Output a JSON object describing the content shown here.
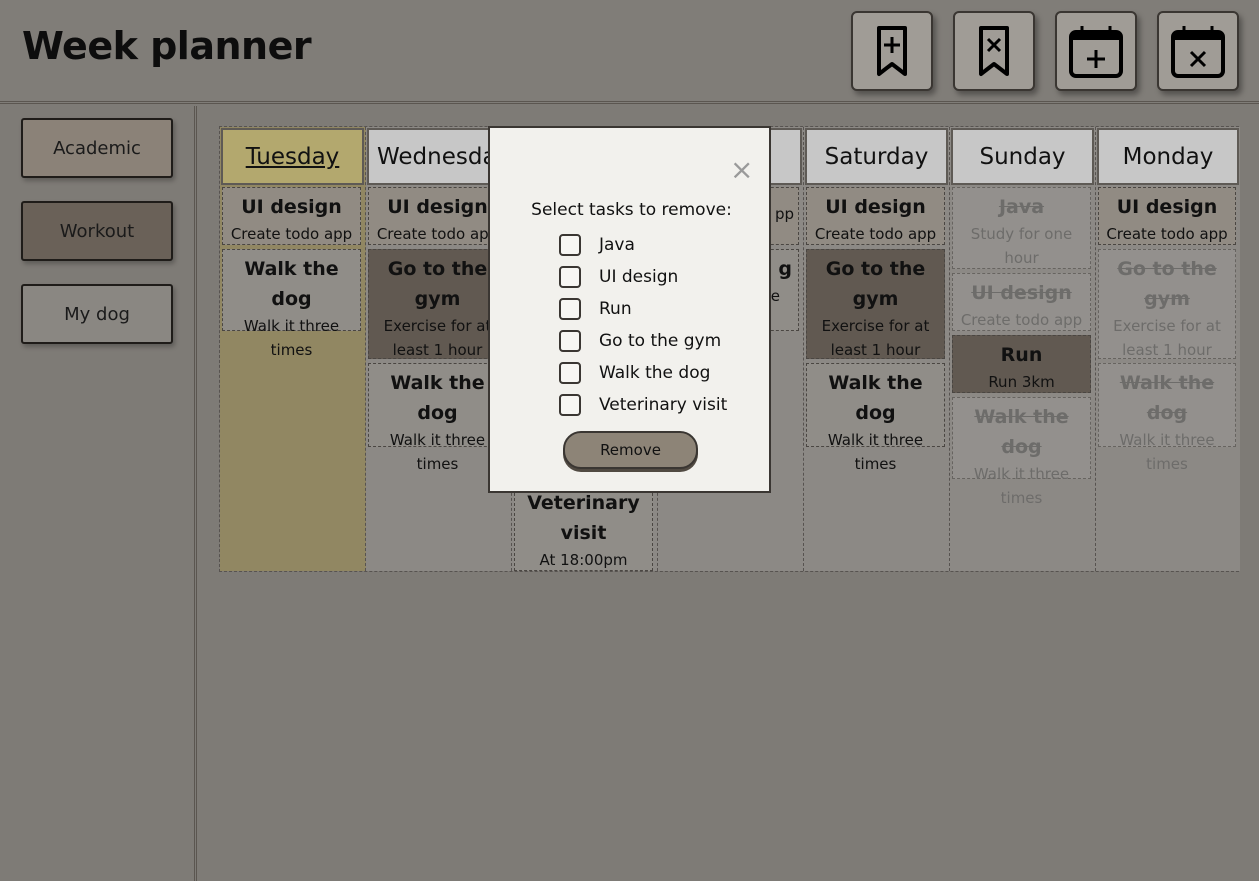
{
  "app": {
    "title": "Week planner"
  },
  "toolbar": {
    "buttons": [
      {
        "icon": "bookmark-add-icon"
      },
      {
        "icon": "bookmark-remove-icon"
      },
      {
        "icon": "calendar-add-icon"
      },
      {
        "icon": "calendar-remove-icon"
      }
    ]
  },
  "categories": [
    {
      "label": "Academic",
      "color": "#8b8278"
    },
    {
      "label": "Workout",
      "color": "#6a6158"
    },
    {
      "label": "My dog",
      "color": "#8a8782"
    }
  ],
  "days": [
    {
      "name": "Tuesday",
      "today": true,
      "tasks": [
        {
          "title": "UI design",
          "desc": "Create todo app"
        },
        {
          "title": "Walk the dog",
          "desc": "Walk it three times"
        }
      ]
    },
    {
      "name": "Wednesday",
      "tasks": [
        {
          "title": "UI design",
          "desc": "Create todo app"
        },
        {
          "title": "Go to the gym",
          "desc": "Exercise for at least 1 hour"
        },
        {
          "title": "Walk the dog",
          "desc": "Walk it three times"
        }
      ]
    },
    {
      "name": "",
      "tasks": [
        {
          "title": "Veterinary visit",
          "desc": "At 18:00pm"
        }
      ]
    },
    {
      "name": "",
      "tasks": [
        {
          "title": "",
          "desc": "pp"
        },
        {
          "title": "g",
          "desc": "e"
        }
      ]
    },
    {
      "name": "Saturday",
      "tasks": [
        {
          "title": "UI design",
          "desc": "Create todo app"
        },
        {
          "title": "Go to the gym",
          "desc": "Exercise for at least 1 hour"
        },
        {
          "title": "Walk the dog",
          "desc": "Walk it three times"
        }
      ]
    },
    {
      "name": "Sunday",
      "tasks": [
        {
          "title": "Java",
          "desc": "Study for one hour",
          "done": true
        },
        {
          "title": "UI design",
          "desc": "Create todo app",
          "done": true
        },
        {
          "title": "Run",
          "desc": "Run 3km"
        },
        {
          "title": "Walk the dog",
          "desc": "Walk it three times",
          "done": true
        }
      ]
    },
    {
      "name": "Monday",
      "tasks": [
        {
          "title": "UI design",
          "desc": "Create todo app"
        },
        {
          "title": "Go to the gym",
          "desc": "Exercise for at least 1 hour",
          "done": true
        },
        {
          "title": "Walk the dog",
          "desc": "Walk it three times",
          "done": true
        }
      ]
    }
  ],
  "modal": {
    "close": "×",
    "heading": "Select tasks to remove:",
    "options": [
      "Java",
      "UI design",
      "Run",
      "Go to the gym",
      "Walk the dog",
      "Veterinary visit"
    ],
    "remove_label": "Remove"
  }
}
